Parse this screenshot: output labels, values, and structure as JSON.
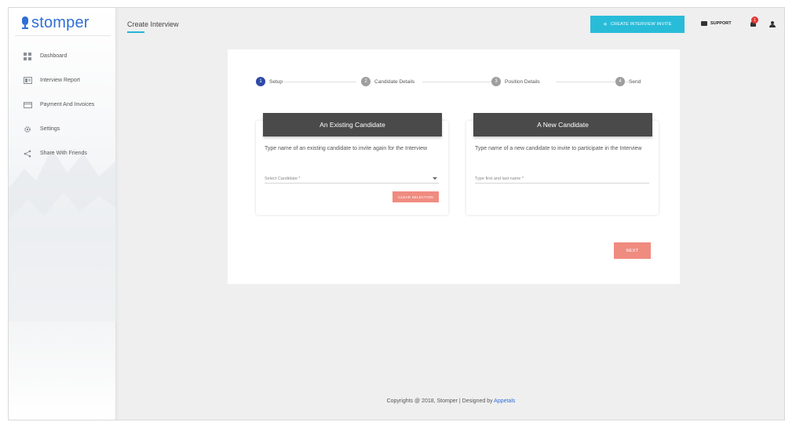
{
  "app": {
    "brand": "stomper"
  },
  "sidebar": {
    "items": [
      {
        "label": "Dashboard",
        "icon": "dashboard-icon"
      },
      {
        "label": "Interview Report",
        "icon": "report-icon"
      },
      {
        "label": "Payment And Invoices",
        "icon": "card-icon"
      },
      {
        "label": "Settings",
        "icon": "gear-icon"
      },
      {
        "label": "Share With Friends",
        "icon": "share-icon"
      }
    ]
  },
  "header": {
    "title": "Create Interview",
    "invite_label": "CREATE INTERVIEW INVITE",
    "support_label": "SUPPORT",
    "notification_count": "1"
  },
  "stepper": {
    "steps": [
      {
        "num": "1",
        "label": "Setup"
      },
      {
        "num": "2",
        "label": "Candidate Details"
      },
      {
        "num": "3",
        "label": "Position Details"
      },
      {
        "num": "4",
        "label": "Send"
      }
    ]
  },
  "existing": {
    "title": "An Existing Candidate",
    "description": "Type name of an existing candidate to invite again for the Interview",
    "placeholder": "Select Candidate *",
    "clear_label": "CLEAR SELECTION"
  },
  "new_candidate": {
    "title": "A New Candidate",
    "description": "Type name of a new candidate to invite to participate in the Interview",
    "placeholder": "Type first and last name *"
  },
  "actions": {
    "next_label": "NEXT"
  },
  "footer": {
    "text": "Copyrights @ 2018, Stomper | Designed by ",
    "link": "Appetals"
  },
  "colors": {
    "accent": "#29bcd9",
    "brand": "#2f6fd6",
    "salmon": "#f08b80",
    "card_header": "#4a4a4a",
    "step_active": "#2f49a8"
  }
}
